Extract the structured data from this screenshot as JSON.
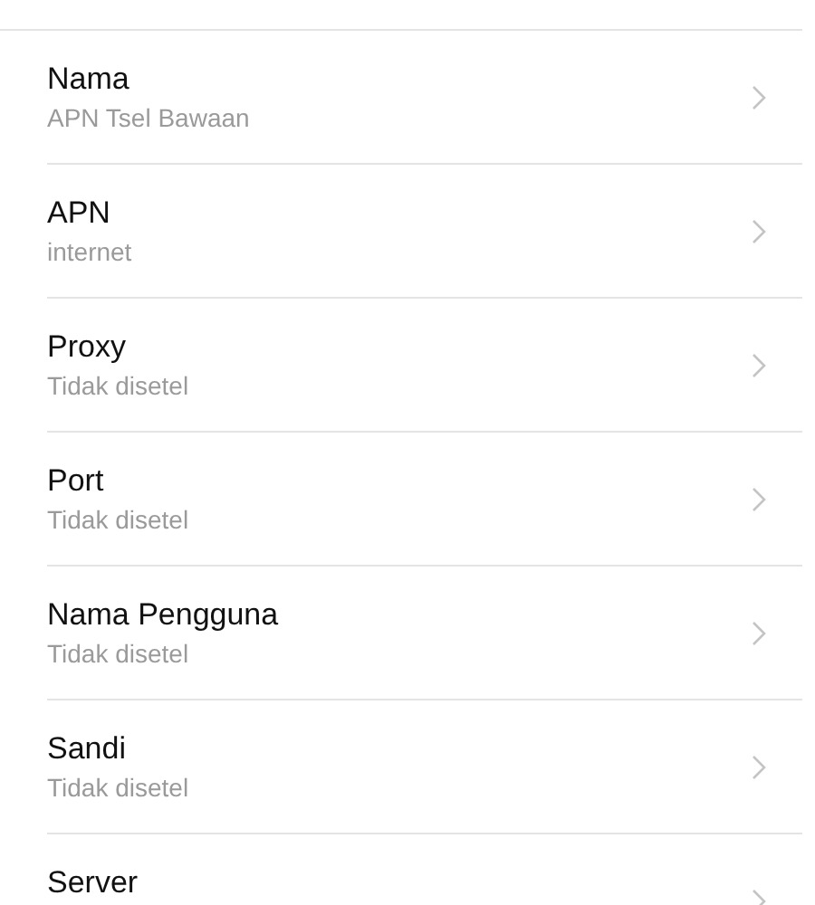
{
  "settings": [
    {
      "label": "Nama",
      "value": "APN Tsel Bawaan"
    },
    {
      "label": "APN",
      "value": "internet"
    },
    {
      "label": "Proxy",
      "value": "Tidak disetel"
    },
    {
      "label": "Port",
      "value": "Tidak disetel"
    },
    {
      "label": "Nama Pengguna",
      "value": "Tidak disetel"
    },
    {
      "label": "Sandi",
      "value": "Tidak disetel"
    },
    {
      "label": "Server"
    }
  ]
}
